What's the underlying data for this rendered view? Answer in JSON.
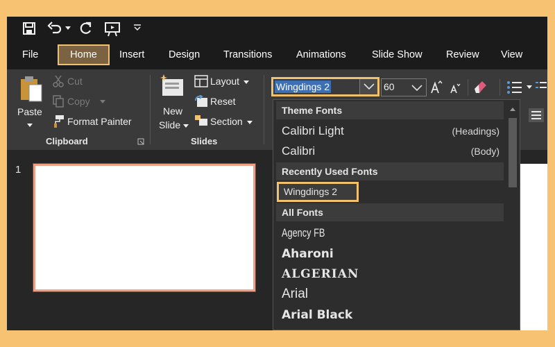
{
  "quick_access": {
    "icons": [
      "save-icon",
      "undo-icon",
      "undo-dropdown-icon",
      "redo-icon",
      "start-slideshow-icon",
      "customize-qat-icon"
    ]
  },
  "tabs": [
    {
      "label": "File"
    },
    {
      "label": "Home",
      "active": true
    },
    {
      "label": "Insert"
    },
    {
      "label": "Design"
    },
    {
      "label": "Transitions"
    },
    {
      "label": "Animations"
    },
    {
      "label": "Slide Show"
    },
    {
      "label": "Review"
    },
    {
      "label": "View"
    }
  ],
  "ribbon": {
    "clipboard": {
      "paste": "Paste",
      "cut": "Cut",
      "copy": "Copy",
      "format_painter": "Format Painter",
      "group_label": "Clipboard"
    },
    "slides": {
      "new_slide_line1": "New",
      "new_slide_line2": "Slide",
      "layout": "Layout",
      "reset": "Reset",
      "section": "Section",
      "group_label": "Slides"
    },
    "font": {
      "font_name": "Wingdings 2",
      "font_size": "60"
    }
  },
  "font_dropdown": {
    "theme_fonts_header": "Theme Fonts",
    "theme_fonts": [
      {
        "name": "Calibri Light",
        "note": "(Headings)"
      },
      {
        "name": "Calibri",
        "note": "(Body)"
      }
    ],
    "recent_header": "Recently Used Fonts",
    "recent": [
      {
        "name": "Wingdings 2"
      }
    ],
    "all_header": "All Fonts",
    "all_fonts": [
      {
        "name": "Agency FB"
      },
      {
        "name": "Aharoni"
      },
      {
        "name": "ALGERIAN"
      },
      {
        "name": "Arial"
      },
      {
        "name": "Arial Black"
      }
    ]
  },
  "slide_panel": {
    "slide_number": "1"
  },
  "colors": {
    "highlight": "#f2c16e",
    "selection_blue": "#3d6fb4",
    "thumbnail_border": "#ef9f83"
  }
}
